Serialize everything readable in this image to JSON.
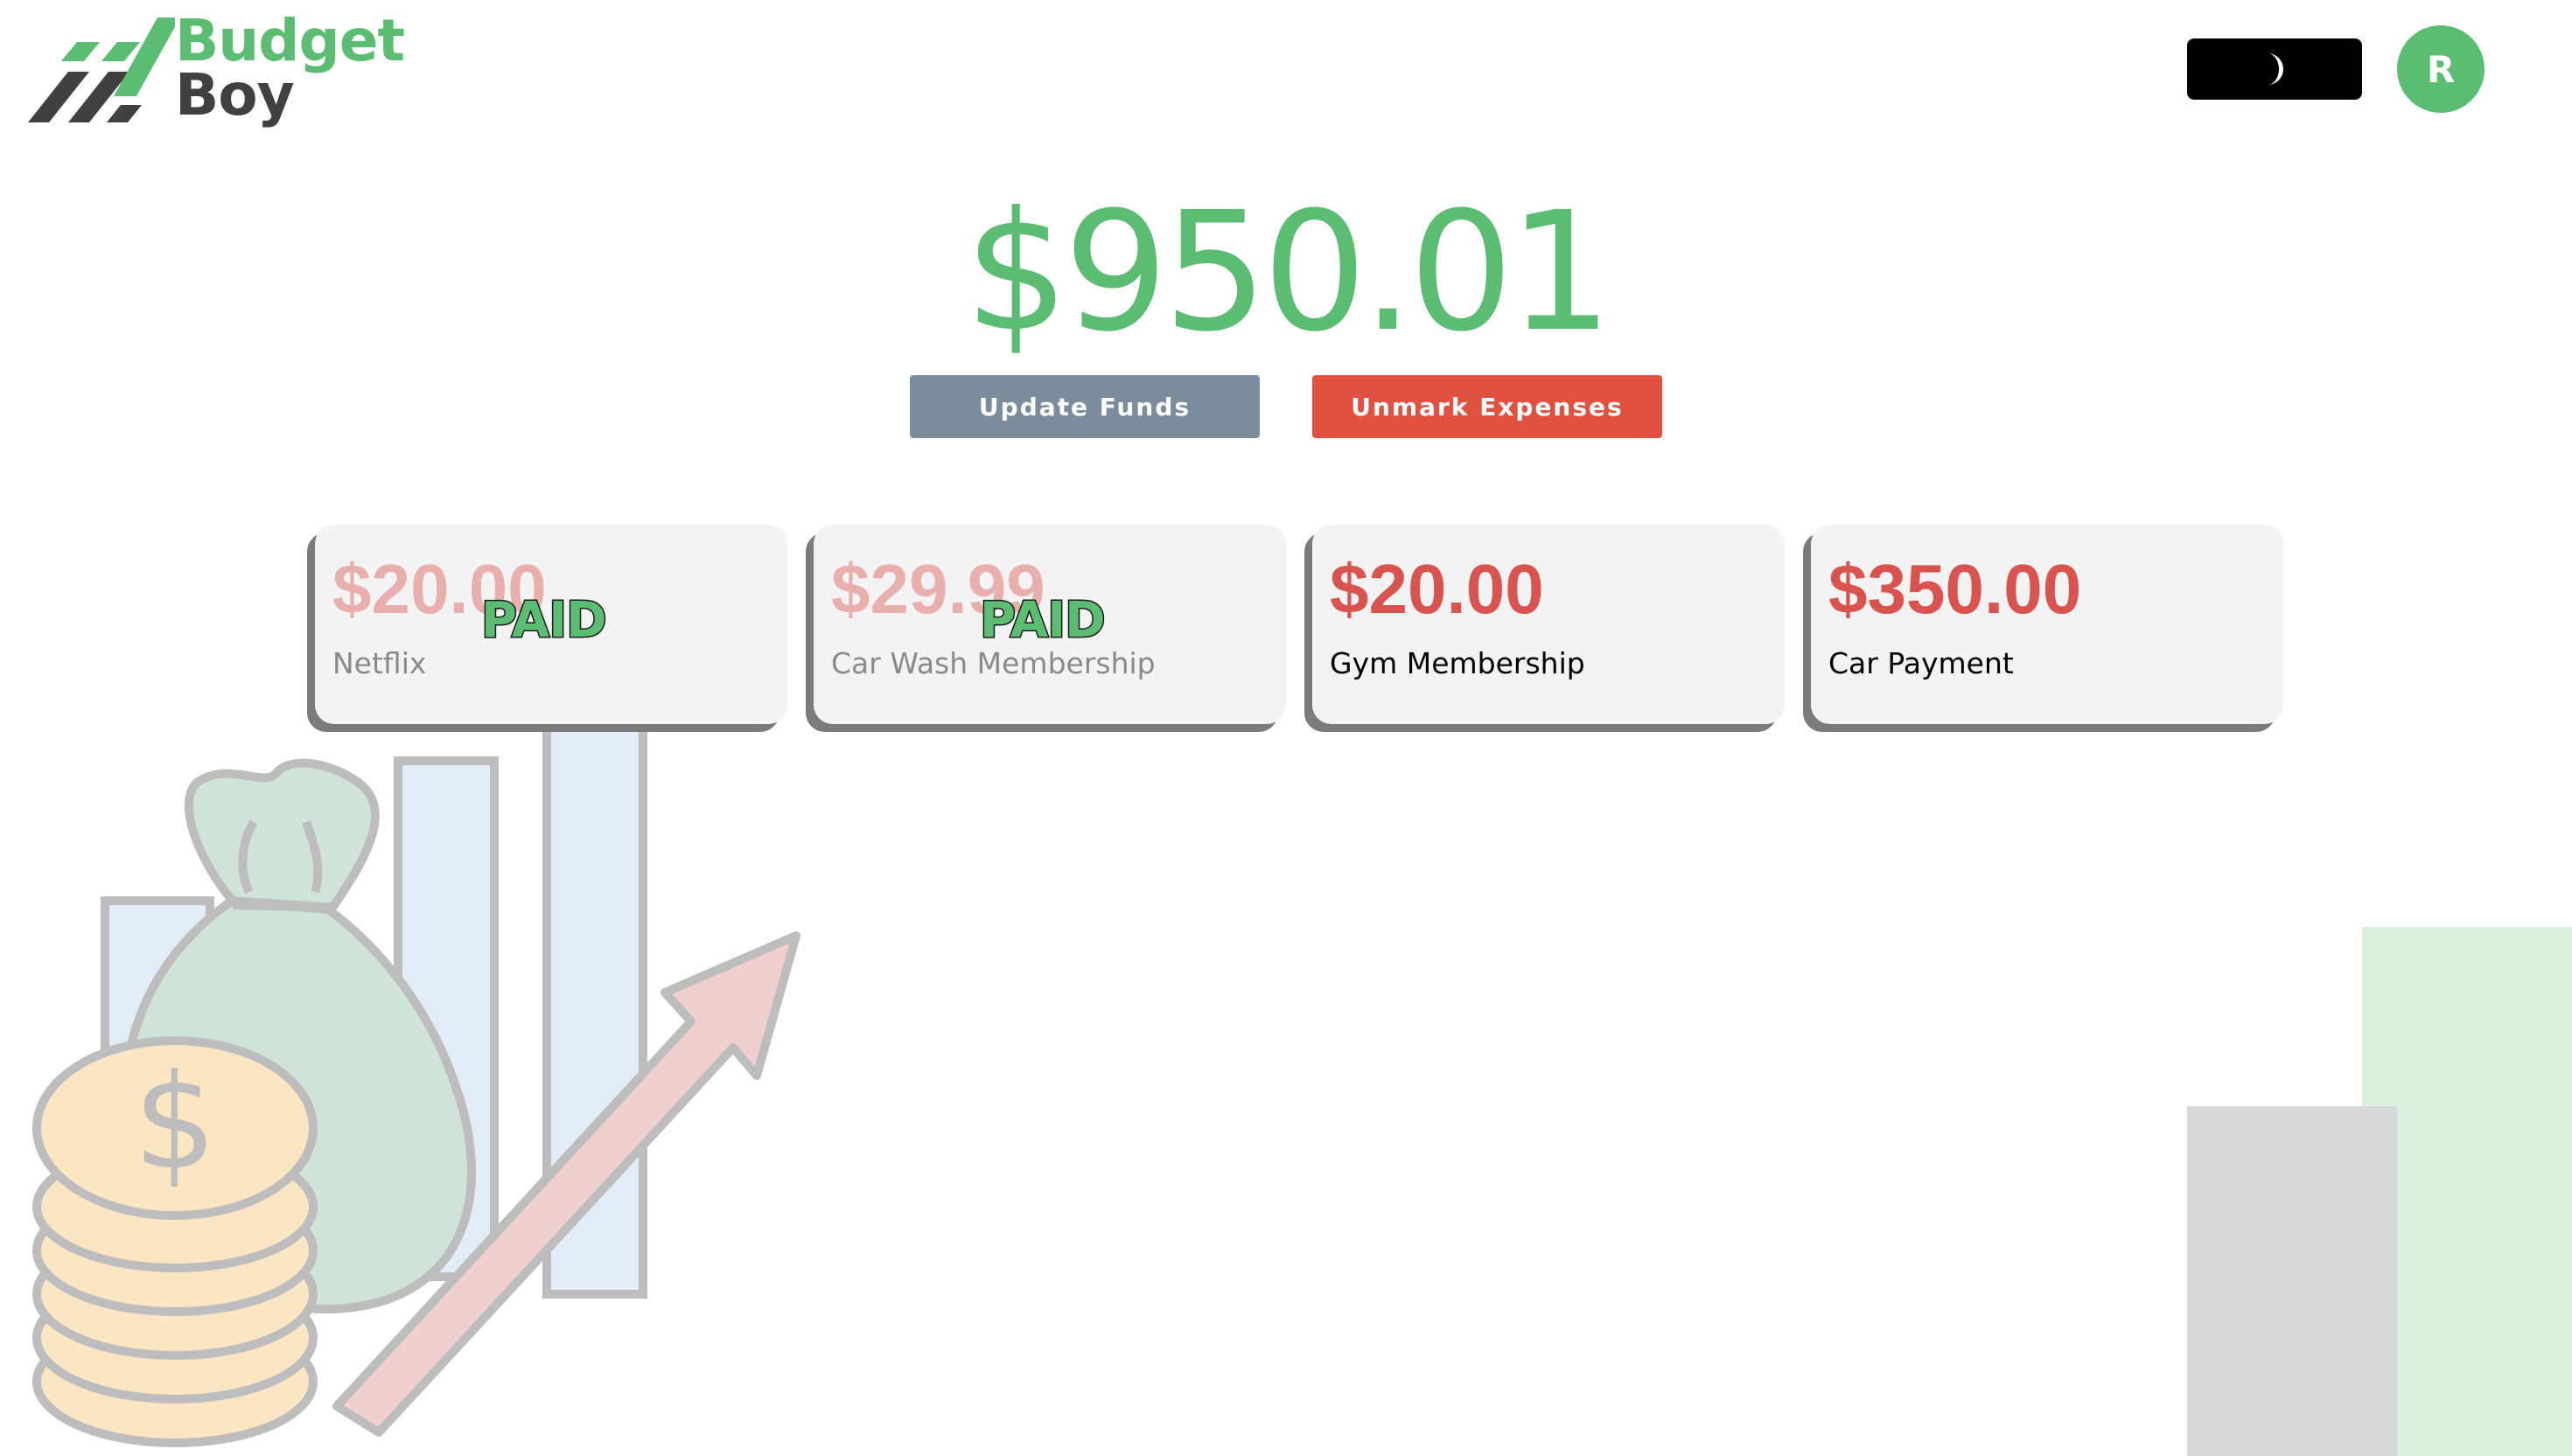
{
  "brand": {
    "line1": "Budget",
    "line2": "Boy"
  },
  "header": {
    "theme_toggle_icon": "moon-icon",
    "avatar_initial": "R"
  },
  "balance": {
    "amount": "$950.01"
  },
  "actions": {
    "update_funds_label": "Update Funds",
    "unmark_expenses_label": "Unmark Expenses"
  },
  "expenses": [
    {
      "amount": "$20.00",
      "name": "Netflix",
      "paid": true,
      "stamp": "PAID"
    },
    {
      "amount": "$29.99",
      "name": "Car Wash Membership",
      "paid": true,
      "stamp": "PAID"
    },
    {
      "amount": "$20.00",
      "name": "Gym Membership",
      "paid": false,
      "stamp": ""
    },
    {
      "amount": "$350.00",
      "name": "Car Payment",
      "paid": false,
      "stamp": ""
    }
  ],
  "colors": {
    "brand_green": "#5bbd72",
    "brand_dark": "#404040",
    "expense_red": "#d9534f",
    "update_button": "#7b8d9d",
    "unmark_button": "#e0513f",
    "card_background": "#f3f3f3",
    "card_shadow": "#7b7b7b",
    "toggle_background": "#000000"
  }
}
